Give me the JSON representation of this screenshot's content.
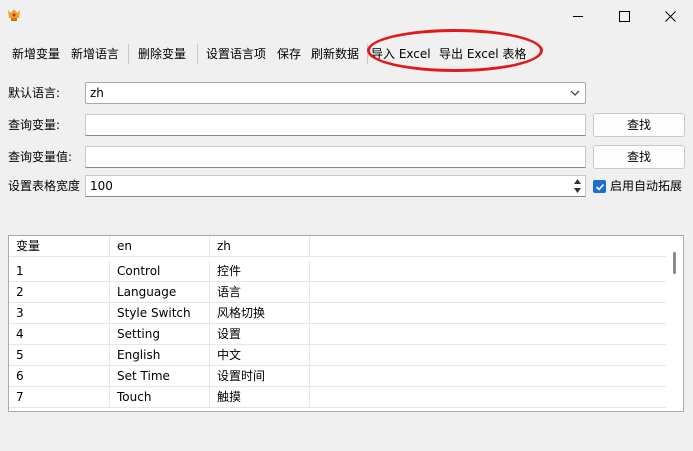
{
  "window": {
    "minimize_icon": "minimize-icon",
    "maximize_icon": "maximize-icon",
    "close_icon": "close-icon"
  },
  "toolbar": {
    "add_variable": "新增变量",
    "add_language": "新增语言",
    "delete_variable": "删除变量",
    "set_language_item": "设置语言项",
    "save": "保存",
    "refresh_data": "刷新数据",
    "import_excel": "导入 Excel",
    "export_excel": "导出 Excel 表格"
  },
  "form": {
    "default_language_label": "默认语言:",
    "default_language_value": "zh",
    "query_variable_label": "查询变量:",
    "query_variable_value": "",
    "query_value_label": "查询变量值:",
    "query_value_value": "",
    "find_button": "查找",
    "find_button_2": "查找",
    "table_width_label": "设置表格宽度",
    "table_width_value": "100",
    "auto_expand_label": "启用自动拓展",
    "auto_expand_checked": true
  },
  "table": {
    "headers": [
      "变量",
      "en",
      "zh"
    ],
    "rows": [
      [
        "1",
        "Control",
        "控件"
      ],
      [
        "2",
        "Language",
        "语言"
      ],
      [
        "3",
        "Style Switch",
        "风格切换"
      ],
      [
        "4",
        "Setting",
        "设置"
      ],
      [
        "5",
        "English",
        "中文"
      ],
      [
        "6",
        "Set Time",
        "设置时间"
      ],
      [
        "7",
        "Touch",
        "触摸"
      ]
    ]
  },
  "colors": {
    "highlight": "#e01a1a",
    "accent": "#1a6fd1",
    "window_bg": "#f0f0f0"
  }
}
